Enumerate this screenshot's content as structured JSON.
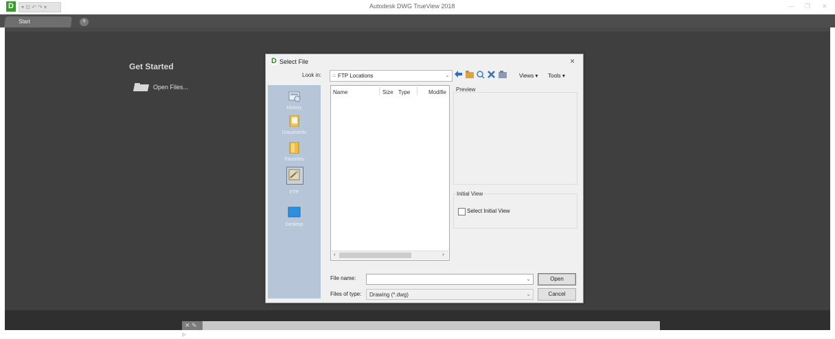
{
  "app": {
    "title": "Autodesk DWG TrueView 2018",
    "logo_letter": "D",
    "quick_access": "▾ ⊡ ↶ ↷ ▾",
    "minimize": "—",
    "restore": "❐",
    "close": "✕"
  },
  "tabs": [
    {
      "label": "Start",
      "active": true
    }
  ],
  "tab_add": "+",
  "start_page": {
    "heading": "Get Started",
    "open_files": "Open Files..."
  },
  "dialog": {
    "title": "Select File",
    "icon_letter": "D",
    "close_label": "×",
    "look_in_label": "Look in:",
    "look_in_value": "FTP Locations",
    "toolbar": {
      "views_label": "Views",
      "tools_label": "Tools",
      "back_icon": "←",
      "up_icon": "up-folder",
      "search_icon": "search",
      "delete_icon": "×",
      "newfolder_icon": "new-folder"
    },
    "places": [
      {
        "label": "History",
        "icon": "history-icon"
      },
      {
        "label": "Documents",
        "icon": "documents-icon"
      },
      {
        "label": "Favorites",
        "icon": "favorites-icon"
      },
      {
        "label": "FTP",
        "icon": "ftp-icon",
        "selected": true
      },
      {
        "label": "Desktop",
        "icon": "desktop-icon"
      }
    ],
    "columns": [
      "Name",
      "Size",
      "Type",
      "Modifie"
    ],
    "preview_label": "Preview",
    "initial_view_label": "Initial View",
    "select_initial_view": "Select Initial View",
    "file_name_label": "File name:",
    "file_name_value": "",
    "files_of_type_label": "Files of type:",
    "files_of_type_value": "Drawing (*.dwg)",
    "open_button": "Open",
    "cancel_button": "Cancel"
  },
  "command_line": {
    "icons": "✕ ✎ ▶"
  },
  "colors": {
    "workspace": "#3f3f3f",
    "places_bar": "#b6c6d8",
    "logo_green": "#3c9a2c",
    "dialog_bg": "#f0f0f0"
  }
}
